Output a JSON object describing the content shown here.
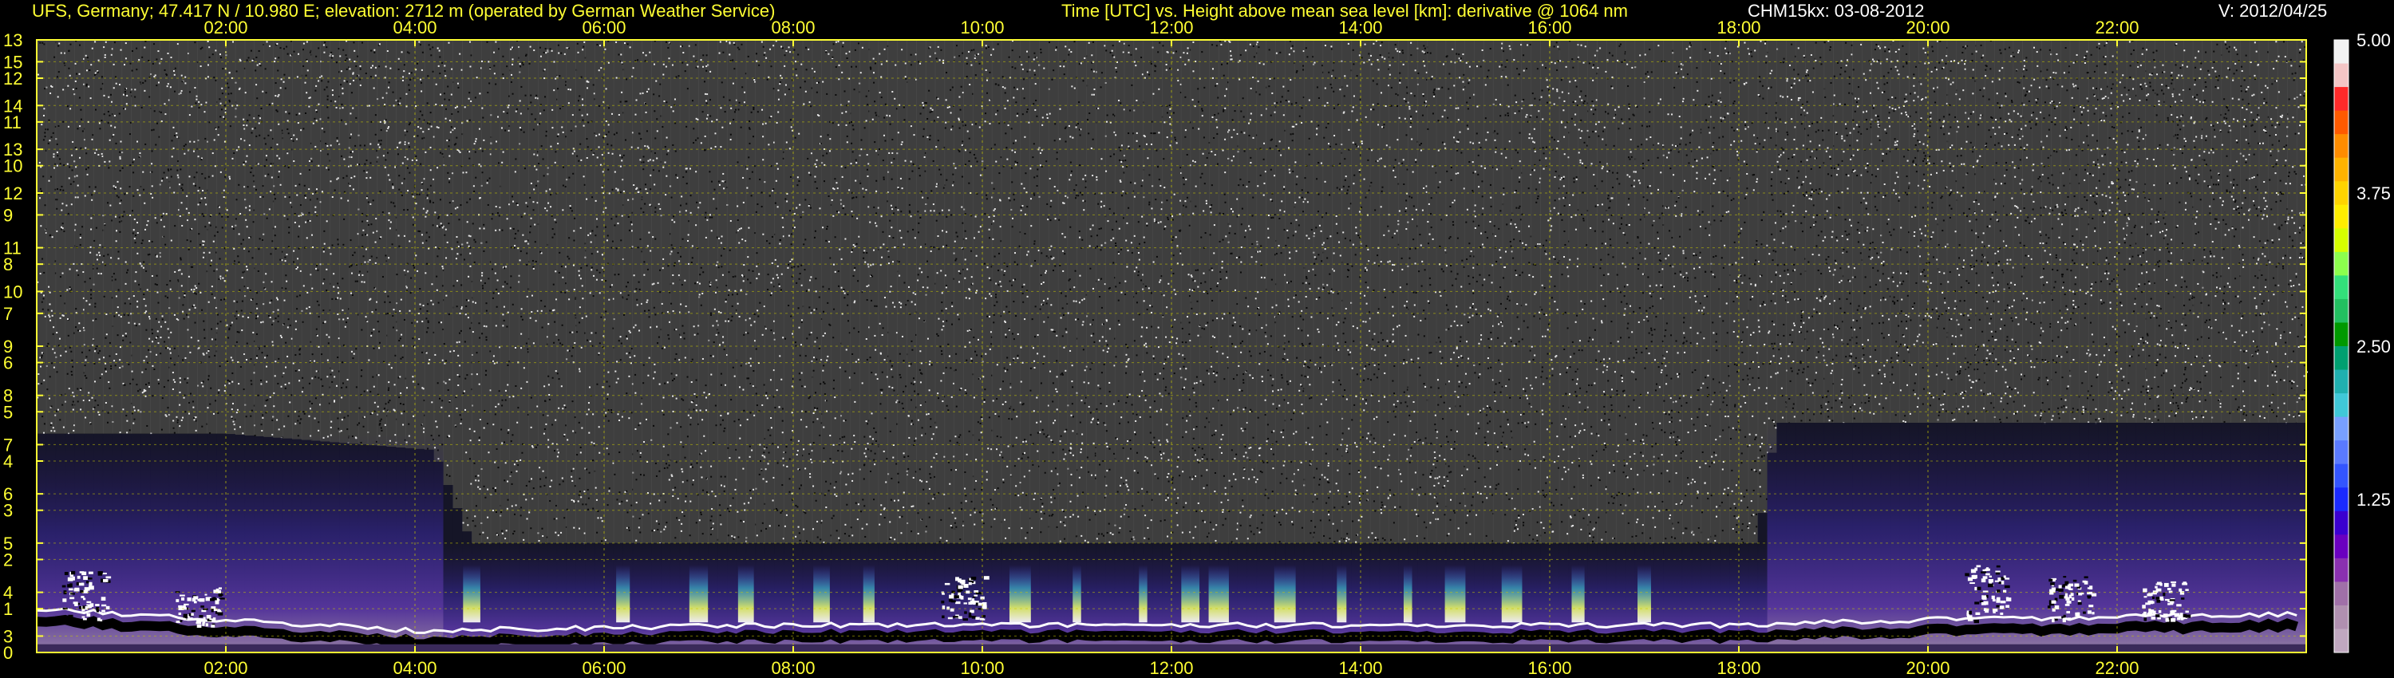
{
  "header": {
    "station": "UFS, Germany; 47.417 N / 10.980 E; elevation: 2712 m  (operated by German Weather Service)",
    "axes_title": "Time [UTC] vs. Height above mean sea level [km]: derivative @ 1064 nm",
    "instrument_date": "CHM15kx: 03-08-2012",
    "version": "V: 2012/04/25"
  },
  "chart_data": {
    "type": "heatmap",
    "title": "Time [UTC] vs. Height above mean sea level [km]: derivative @ 1064 nm",
    "x_ticks": [
      "02:00",
      "04:00",
      "06:00",
      "08:00",
      "10:00",
      "12:00",
      "14:00",
      "16:00",
      "18:00",
      "20:00",
      "22:00"
    ],
    "x_range_hours": [
      0,
      24
    ],
    "y_left_ticks": [
      {
        "label": "13",
        "km": 13.0
      },
      {
        "label": "15",
        "km": 12.6
      },
      {
        "label": "12",
        "km": 12.3
      },
      {
        "label": "14",
        "km": 11.8
      },
      {
        "label": "11",
        "km": 11.5
      },
      {
        "label": "13",
        "km": 11.0
      },
      {
        "label": "10",
        "km": 10.7
      },
      {
        "label": "12",
        "km": 10.2
      },
      {
        "label": "9",
        "km": 9.8
      },
      {
        "label": "11",
        "km": 9.2
      },
      {
        "label": "8",
        "km": 8.9
      },
      {
        "label": "10",
        "km": 8.4
      },
      {
        "label": "7",
        "km": 8.0
      },
      {
        "label": "9",
        "km": 7.4
      },
      {
        "label": "6",
        "km": 7.1
      },
      {
        "label": "8",
        "km": 6.5
      },
      {
        "label": "5",
        "km": 6.2
      },
      {
        "label": "7",
        "km": 5.6
      },
      {
        "label": "4",
        "km": 5.3
      },
      {
        "label": "6",
        "km": 4.7
      },
      {
        "label": "3",
        "km": 4.4
      },
      {
        "label": "5",
        "km": 3.8
      },
      {
        "label": "2",
        "km": 3.5
      },
      {
        "label": "4",
        "km": 2.9
      },
      {
        "label": "1",
        "km": 2.6
      },
      {
        "label": "3",
        "km": 2.1
      },
      {
        "label": "0",
        "km": 1.8
      }
    ],
    "colorbar": {
      "labels": [
        "5.00",
        "3.75",
        "2.50",
        "1.25"
      ],
      "range": [
        0,
        5
      ],
      "colors": [
        "#f2f2f2",
        "#f4c6c6",
        "#ff2a2a",
        "#ff5a00",
        "#ff8c00",
        "#ffb300",
        "#ffd400",
        "#ffee00",
        "#d6ff00",
        "#8cff4d",
        "#33e07a",
        "#22c060",
        "#009900",
        "#00a070",
        "#20b0b0",
        "#40c8d8",
        "#78a0ff",
        "#5a7aff",
        "#3355ff",
        "#1a2aff",
        "#3a00d0",
        "#6a00c0",
        "#8a30b0",
        "#a070a8",
        "#b090b0",
        "#c0a8c0"
      ]
    },
    "grid": true,
    "noise_ceiling_km": [
      {
        "hour": 0,
        "km": 5.8
      },
      {
        "hour": 2,
        "km": 5.8
      },
      {
        "hour": 4.2,
        "km": 5.5
      },
      {
        "hour": 4.6,
        "km": 3.8
      },
      {
        "hour": 18.2,
        "km": 3.8
      },
      {
        "hour": 18.4,
        "km": 6.0
      },
      {
        "hour": 24,
        "km": 6.0
      }
    ],
    "boundary_layer_top_km": [
      {
        "hour": 0,
        "km": 2.6
      },
      {
        "hour": 1,
        "km": 2.5
      },
      {
        "hour": 4,
        "km": 2.2
      },
      {
        "hour": 8,
        "km": 2.3
      },
      {
        "hour": 12,
        "km": 2.3
      },
      {
        "hour": 16,
        "km": 2.3
      },
      {
        "hour": 18,
        "km": 2.3
      },
      {
        "hour": 20,
        "km": 2.4
      },
      {
        "hour": 24,
        "km": 2.5
      }
    ],
    "cloud_features": [
      {
        "hour": 0.5,
        "km_top": 3.3,
        "km_bottom": 2.4
      },
      {
        "hour": 1.7,
        "km_top": 3.0,
        "km_bottom": 2.3
      },
      {
        "hour": 9.8,
        "km_top": 3.2,
        "km_bottom": 2.4
      },
      {
        "hour": 20.6,
        "km_top": 3.4,
        "km_bottom": 2.4
      },
      {
        "hour": 21.5,
        "km_top": 3.2,
        "km_bottom": 2.4
      },
      {
        "hour": 22.5,
        "km_top": 3.1,
        "km_bottom": 2.4
      }
    ],
    "bright_plumes": [
      {
        "hour": 4.6
      },
      {
        "hour": 6.2
      },
      {
        "hour": 7.0
      },
      {
        "hour": 7.5
      },
      {
        "hour": 8.3
      },
      {
        "hour": 8.8
      },
      {
        "hour": 10.4
      },
      {
        "hour": 11.0
      },
      {
        "hour": 11.7
      },
      {
        "hour": 12.2
      },
      {
        "hour": 12.5
      },
      {
        "hour": 13.2
      },
      {
        "hour": 13.8
      },
      {
        "hour": 14.5
      },
      {
        "hour": 15.0
      },
      {
        "hour": 15.6
      },
      {
        "hour": 16.3
      },
      {
        "hour": 17.0
      }
    ]
  }
}
